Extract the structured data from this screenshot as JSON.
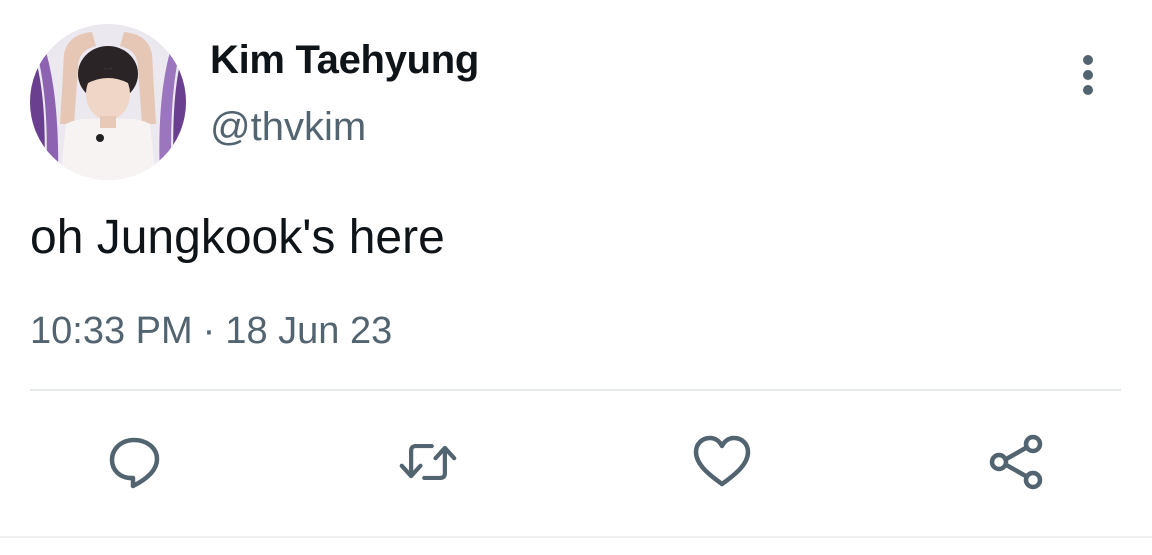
{
  "tweet": {
    "author": {
      "display_name": "Kim Taehyung",
      "handle": "@thvkim"
    },
    "text": "oh Jungkook's here",
    "time": "10:33 PM",
    "separator": "·",
    "date": "18 Jun 23"
  },
  "actions": {
    "reply_icon": "comment-icon",
    "retweet_icon": "retweet-icon",
    "like_icon": "heart-icon",
    "share_icon": "share-icon",
    "more_icon": "vertical-ellipsis-icon"
  },
  "colors": {
    "text_primary": "#0f1419",
    "text_secondary": "#536471",
    "icon": "#536471",
    "divider": "#e6e9ec"
  }
}
